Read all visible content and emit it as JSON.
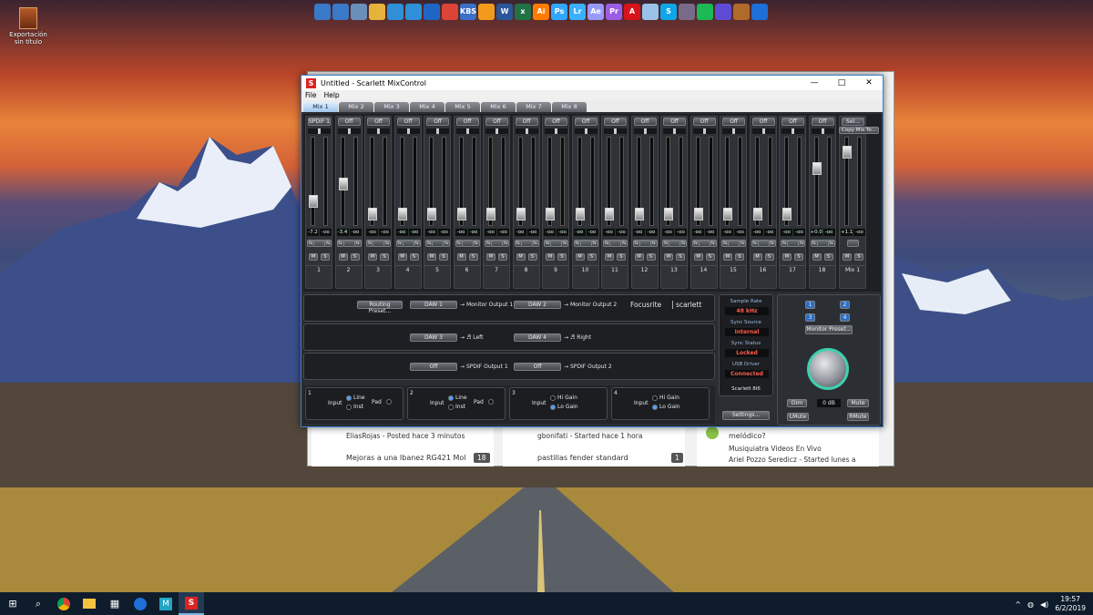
{
  "desktop": {
    "icon_label": "Exportación sin título",
    "dock_icons": [
      "pc-icon",
      "pc-icon",
      "bin-icon",
      "folder-icon",
      "cloud-icon",
      "cloud-icon",
      "edge-icon",
      "chrome-icon",
      "kbs-icon",
      "vlc-icon",
      "word-icon",
      "excel-icon",
      "illustrator-icon",
      "photoshop-icon",
      "lightroom-icon",
      "aftereffects-icon",
      "premiere-icon",
      "acrobat-icon",
      "picture-icon",
      "skype-icon",
      "steam-icon",
      "spotify-icon",
      "browser-icon",
      "pet-icon",
      "teamviewer-icon"
    ],
    "dock_text": [
      "",
      "",
      "",
      "",
      "",
      "",
      "",
      "",
      "KBS",
      "",
      "W",
      "x",
      "Ai",
      "Ps",
      "Lr",
      "Ae",
      "Pr",
      "A",
      "",
      "S",
      "",
      "",
      "",
      "",
      ""
    ]
  },
  "taskbar": {
    "time": "19:57",
    "date": "6/2/2019"
  },
  "forum": {
    "col1_user": "EliasRojas - Posted hace 3 minutos",
    "col1_title": "Mejoras a una Ibanez RG421 Mol",
    "col1_count": "18",
    "col2_user": "gbonifati - Started hace 1 hora",
    "col2_title": "pastillas fender standard",
    "col2_count": "1",
    "col3_line1": "melódico?",
    "col3_line2": "Musiquiatra Videos En Vivo",
    "col3_line3": "Ariel Pozzo Seredicz - Started lunes a"
  },
  "window": {
    "title": "Untitled - Scarlett MixControl",
    "menu": [
      "File",
      "Help"
    ],
    "tabs": [
      "Mix 1",
      "Mix 2",
      "Mix 3",
      "Mix 4",
      "Mix 5",
      "Mix 6",
      "Mix 7",
      "Mix 8"
    ],
    "active_tab": "Mix 1"
  },
  "channels": [
    {
      "src": "SPDIF 1",
      "l": "-7.2",
      "r": "-oo",
      "num": "1"
    },
    {
      "src": "Off",
      "l": "-3.4",
      "r": "-oo",
      "num": "2"
    },
    {
      "src": "Off",
      "l": "-oo",
      "r": "-oo",
      "num": "3"
    },
    {
      "src": "Off",
      "l": "-oo",
      "r": "-oo",
      "num": "4"
    },
    {
      "src": "Off",
      "l": "-oo",
      "r": "-oo",
      "num": "5"
    },
    {
      "src": "Off",
      "l": "-oo",
      "r": "-oo",
      "num": "6"
    },
    {
      "src": "Off",
      "l": "-oo",
      "r": "-oo",
      "num": "7"
    },
    {
      "src": "Off",
      "l": "-oo",
      "r": "-oo",
      "num": "8"
    },
    {
      "src": "Off",
      "l": "-oo",
      "r": "-oo",
      "num": "9"
    },
    {
      "src": "Off",
      "l": "-oo",
      "r": "-oo",
      "num": "10"
    },
    {
      "src": "Off",
      "l": "-oo",
      "r": "-oo",
      "num": "11"
    },
    {
      "src": "Off",
      "l": "-oo",
      "r": "-oo",
      "num": "12"
    },
    {
      "src": "Off",
      "l": "-oo",
      "r": "-oo",
      "num": "13"
    },
    {
      "src": "Off",
      "l": "-oo",
      "r": "-oo",
      "num": "14"
    },
    {
      "src": "Off",
      "l": "-oo",
      "r": "-oo",
      "num": "15"
    },
    {
      "src": "Off",
      "l": "-oo",
      "r": "-oo",
      "num": "16"
    },
    {
      "src": "Off",
      "l": "-oo",
      "r": "-oo",
      "num": "17"
    },
    {
      "src": "Off",
      "l": "+0.0",
      "r": "-oo",
      "num": "18"
    }
  ],
  "master": {
    "src": "Sel...",
    "copy": "Copy Mix To...",
    "l": "+1.1",
    "r": "-oo",
    "num": "Mix 1"
  },
  "strip_buttons": {
    "mute": "M",
    "solo": "S"
  },
  "routing": {
    "preset": "Routing Preset...",
    "row1": [
      {
        "src": "DAW 1",
        "dest": "Monitor Output 1"
      },
      {
        "src": "DAW 2",
        "dest": "Monitor Output 2"
      }
    ],
    "row2": [
      {
        "src": "DAW 3",
        "dest": "Left"
      },
      {
        "src": "DAW 4",
        "dest": "Right"
      }
    ],
    "row3": [
      {
        "src": "Off",
        "dest": "SPDIF Output 1"
      },
      {
        "src": "Off",
        "dest": "SPDIF Output 2"
      }
    ],
    "brand1": "Focusrite",
    "brand2": "scarlett"
  },
  "status": {
    "sample_rate_label": "Sample Rate",
    "sample_rate": "48 kHz",
    "sync_source_label": "Sync Source",
    "sync_source": "Internal",
    "sync_status_label": "Sync Status",
    "sync_status": "Locked",
    "usb_label": "USB Driver",
    "usb": "Connected",
    "device": "Scarlett 8i6",
    "settings": "Settings..."
  },
  "monitor": {
    "preset": "Monitor Preset...",
    "dim": "Dim",
    "level": "0 dB",
    "mute": "Mute",
    "lmute": "LMute",
    "rmute": "RMute",
    "channels": [
      "1",
      "2",
      "3",
      "4"
    ]
  },
  "inputs": [
    {
      "n": "1",
      "label": "Input",
      "opt1": "Line",
      "opt2": "Inst",
      "pad": "Pad"
    },
    {
      "n": "2",
      "label": "Input",
      "opt1": "Line",
      "opt2": "Inst",
      "pad": "Pad"
    },
    {
      "n": "3",
      "label": "Input",
      "opt1": "Hi Gain",
      "opt2": "Lo Gain"
    },
    {
      "n": "4",
      "label": "Input",
      "opt1": "Hi Gain",
      "opt2": "Lo Gain"
    }
  ],
  "colors": {
    "accent": "#3b7fd1",
    "status_red": "#ff5b4b",
    "dial_ring": "#3fd0b0"
  }
}
